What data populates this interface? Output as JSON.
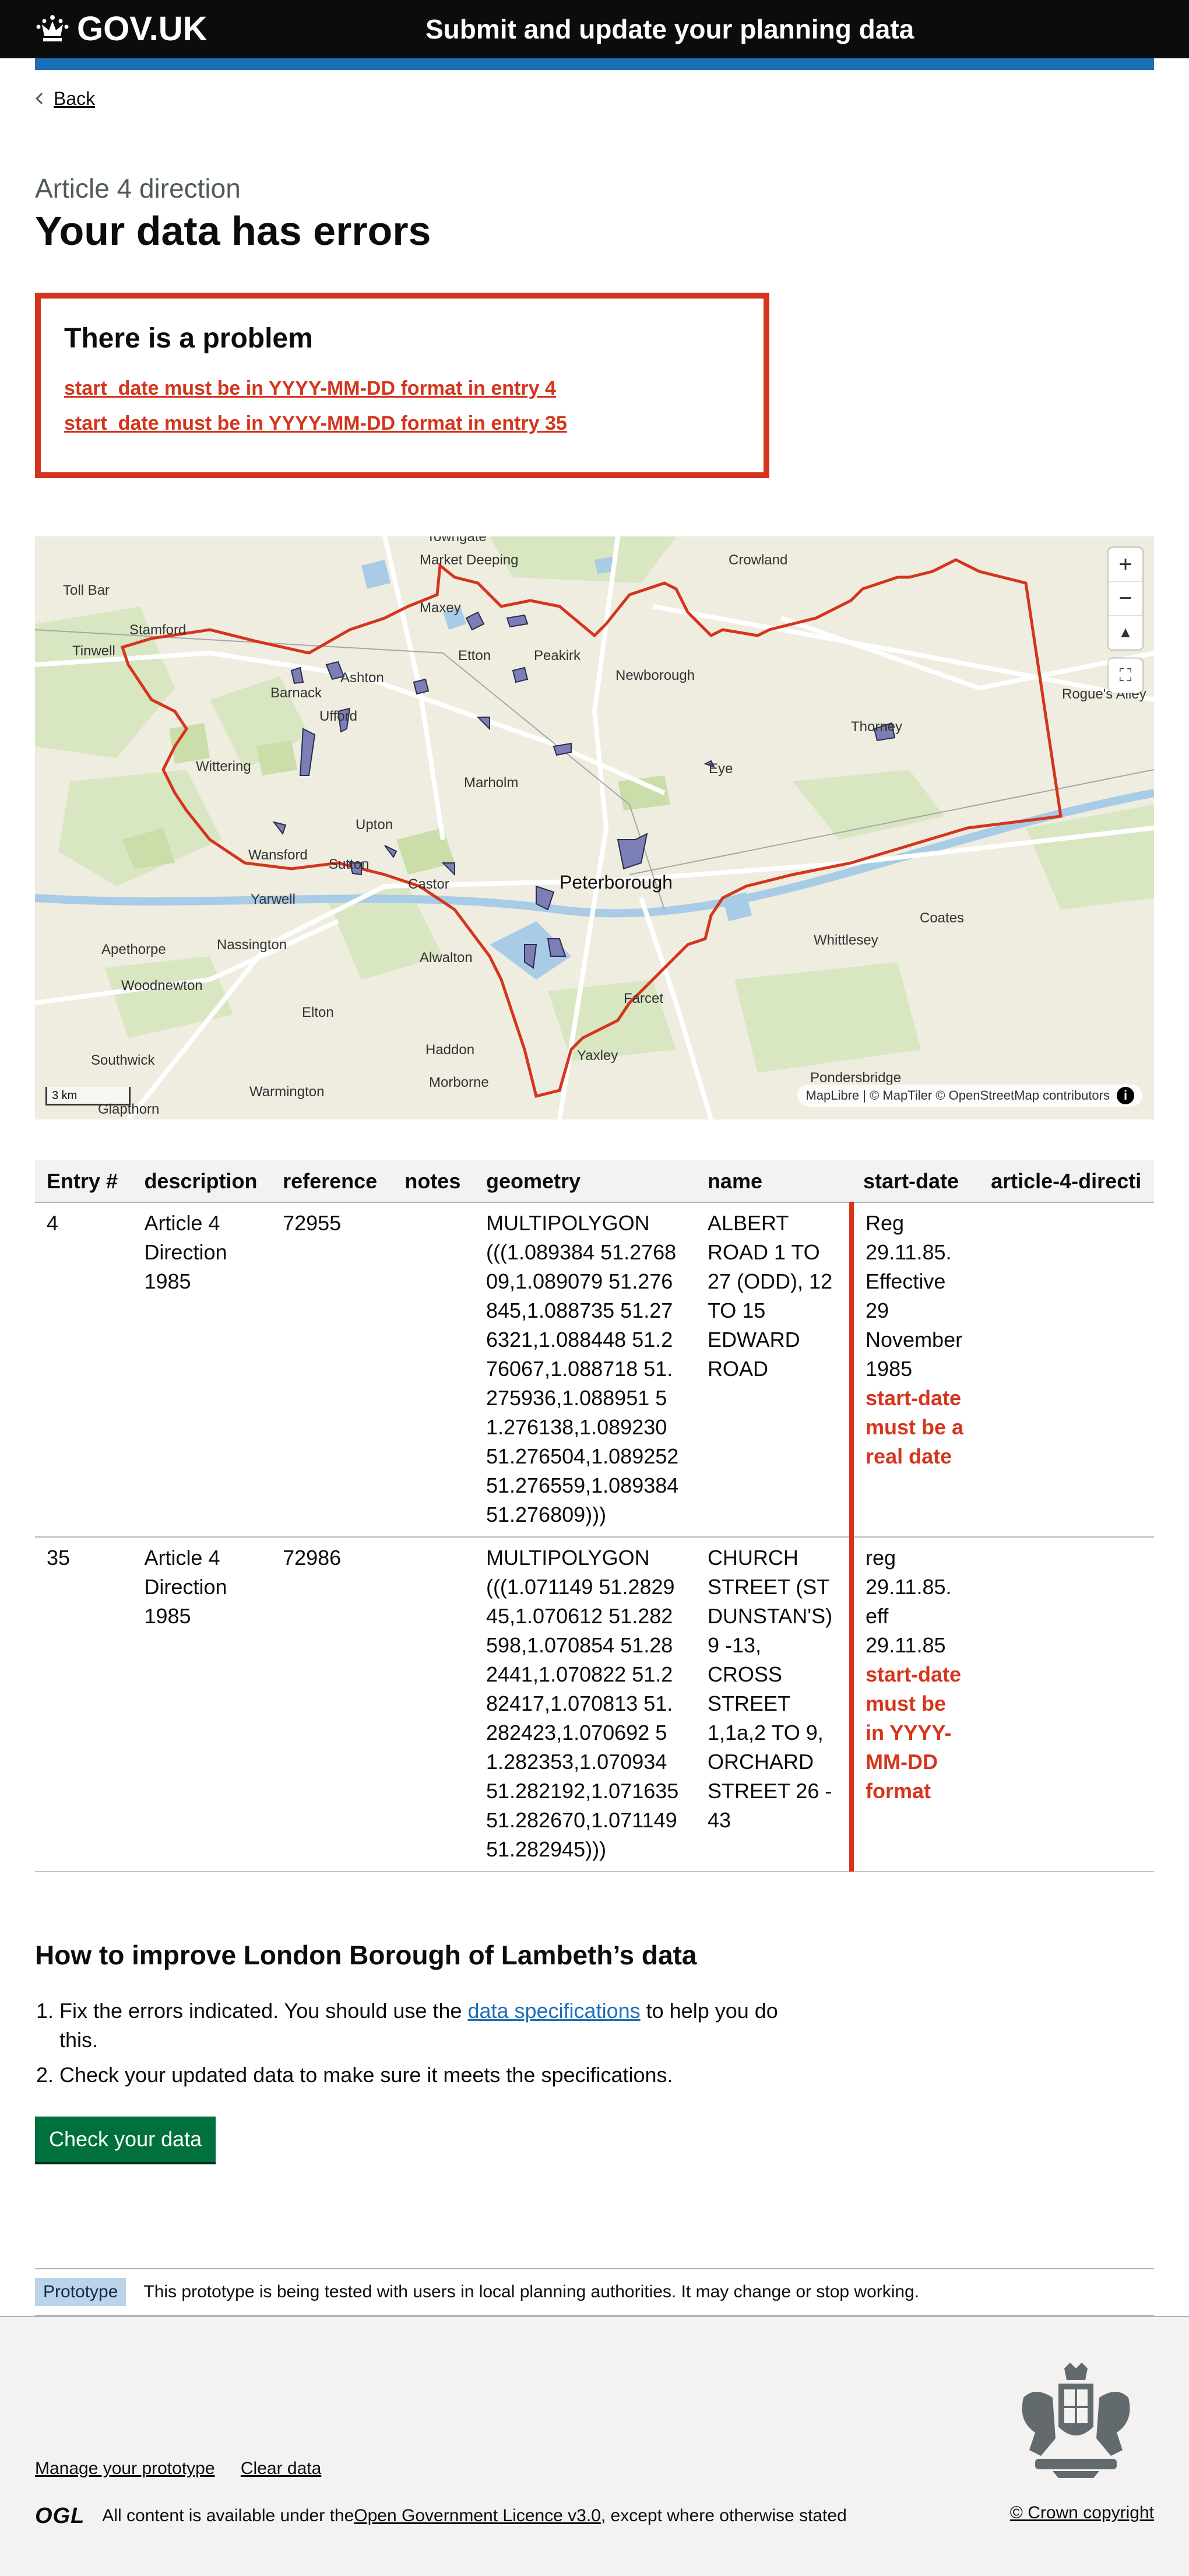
{
  "header": {
    "logo_text": "GOV.UK",
    "service_name": "Submit and update your planning data"
  },
  "back_link": "Back",
  "page": {
    "caption": "Article 4 direction",
    "title": "Your data has errors"
  },
  "error_summary": {
    "title": "There is a problem",
    "errors": [
      "start_date must be in YYYY-MM-DD format in entry 4",
      "start_date must be in YYYY-MM-DD format in entry 35"
    ]
  },
  "map": {
    "attribution": "MapLibre | © MapTiler © OpenStreetMap contributors",
    "scale": "3 km",
    "places": [
      "Towngate",
      "Market Deeping",
      "Crowland",
      "Toll Bar",
      "Maxey",
      "Stamford",
      "Tinwell",
      "Etton",
      "Peakirk",
      "Newborough",
      "Ashton",
      "Barnack",
      "Ufford",
      "Thorney",
      "Rogue's Alley",
      "Wittering",
      "Eye",
      "Marholm",
      "Upton",
      "Wansford",
      "Sutton",
      "Castor",
      "Peterborough",
      "Yarwell",
      "Coates",
      "Whittlesey",
      "Apethorpe",
      "Nassington",
      "Alwalton",
      "Woodnewton",
      "Farcet",
      "Elton",
      "Haddon",
      "Southwick",
      "Yaxley",
      "Morborne",
      "Warmington",
      "Glapthorn",
      "Pondersbridge"
    ]
  },
  "table": {
    "headers": [
      "Entry #",
      "description",
      "reference",
      "notes",
      "geometry",
      "name",
      "start-date",
      "article-4-directi"
    ],
    "rows": [
      {
        "entry": "4",
        "description": "Article 4 Direction 1985",
        "reference": "72955",
        "notes": "",
        "geometry": "MULTIPOLYGON (((1.089384 51.276809,1.089079 51.276845,1.088735 51.276321,1.088448 51.276067,1.088718 51.275936,1.088951 51.276138,1.089230 51.276504,1.089252 51.276559,1.089384 51.276809)))",
        "name": "ALBERT ROAD 1 TO 27 (ODD), 12 TO 15 EDWARD ROAD",
        "start_date": "Reg 29.11.85. Effective 29 November 1985",
        "start_date_error": "start-date must be a real date"
      },
      {
        "entry": "35",
        "description": "Article 4 Direction 1985",
        "reference": "72986",
        "notes": "",
        "geometry": "MULTIPOLYGON (((1.071149 51.282945,1.070612 51.282598,1.070854 51.282441,1.070822 51.282417,1.070813 51.282423,1.070692 51.282353,1.070934 51.282192,1.071635 51.282670,1.071149 51.282945)))",
        "name": "CHURCH STREET (ST DUNSTAN'S) 9 -13, CROSS STREET 1,1a,2 TO 9, ORCHARD STREET 26 - 43",
        "start_date": "reg 29.11.85. eff 29.11.85",
        "start_date_error": "start-date must be in YYYY-MM-DD format"
      }
    ]
  },
  "improve": {
    "title": "How to improve London Borough of Lambeth’s data",
    "step1_before": "Fix the errors indicated. You should use the ",
    "step1_link": "data specifications",
    "step1_after": " to help you do this.",
    "step2": "Check your updated data to make sure it meets the specifications.",
    "button": "Check your data"
  },
  "phase_banner": {
    "tag": "Prototype",
    "text": "This prototype is being tested with users in local planning authorities. It may change or stop working."
  },
  "footer": {
    "link_manage": "Manage your prototype",
    "link_clear": "Clear data",
    "ogl": "OGL",
    "licence_before": "All content is available under the ",
    "licence_link": "Open Government Licence v3.0",
    "licence_after": ", except where otherwise stated",
    "copyright": "© Crown copyright"
  },
  "colors": {
    "error": "#d4351c",
    "link": "#1d70b8",
    "button": "#00703c",
    "header": "#0b0c0c",
    "footer_bg": "#f3f2f1",
    "boundary": "#d4351c",
    "polygon_fill": "#7b7fb6"
  }
}
